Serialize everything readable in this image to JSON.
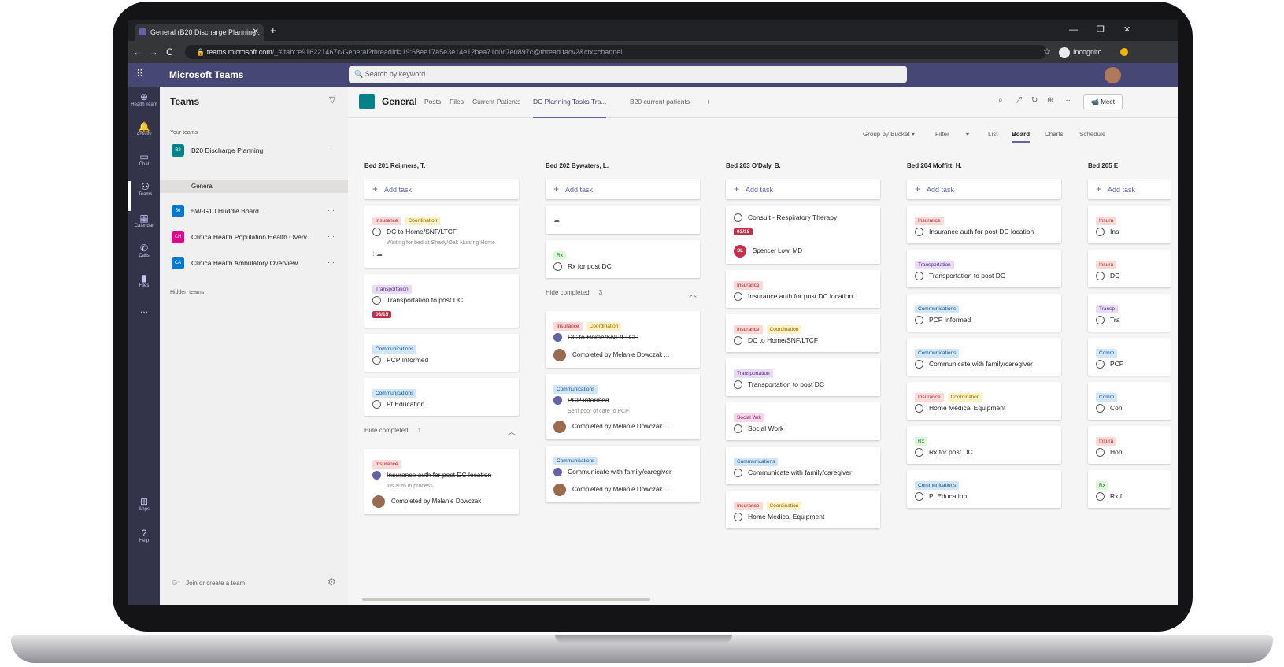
{
  "browser": {
    "tab_title": "General (B20 Discharge Planning...",
    "tab_close": "✕",
    "new_tab": "+",
    "window_controls": [
      "—",
      "❐",
      "✕"
    ],
    "nav": [
      "←",
      "→",
      "C"
    ],
    "url_host": "teams.microsoft.com",
    "url_path": "/_#/tab::e916221467c/General?threadId=19:68ee17a5e3e14e12bea71d0c7e0897c@thread.tacv2&ctx=channel",
    "incognito_label": "Incognito"
  },
  "teams": {
    "app_title": "Microsoft Teams",
    "search_placeholder": "Search by keyword",
    "rail": [
      "Health Team",
      "Activity",
      "Chat",
      "Teams",
      "Calendar",
      "Calls",
      "Files",
      "...",
      "Apps",
      "Help"
    ],
    "panel_title": "Teams",
    "your_teams_label": "Your teams",
    "teams_list": [
      {
        "logo": "B2",
        "name": "B20 Discharge Planning",
        "color": "#038387"
      },
      {
        "logo": "56",
        "name": "5W-G10 Huddle Board",
        "color": "#0078d4"
      },
      {
        "logo": "CH",
        "name": "Clinica Health Population Health Overv...",
        "color": "#e3008c"
      },
      {
        "logo": "CA",
        "name": "Clinica Health Ambulatory Overview",
        "color": "#0078d4"
      }
    ],
    "channel": "General",
    "hidden_teams_label": "Hidden teams",
    "join_label": "Join or create a team"
  },
  "channel_header": {
    "name": "General",
    "tabs": [
      "Posts",
      "Files",
      "Current Patients",
      "DC Planning Tasks Tra...",
      "B20 current patients",
      "+"
    ],
    "meet_label": "Meet"
  },
  "board_bar": {
    "group_by": "Group by Bucket ▾",
    "filter": "Filter",
    "filter_caret": "▾",
    "views": [
      "List",
      "Board",
      "Charts",
      "Schedule"
    ]
  },
  "add_task_label": "Add task",
  "hide_completed_label": "Hide completed",
  "buckets": [
    {
      "title": "Bed 201 Reijmers, T.",
      "cards": [
        {
          "labels": [
            [
              "Insurance",
              "red"
            ],
            [
              "Coordination",
              "yellow"
            ]
          ],
          "task": "DC to Home/SNF/LTCF",
          "note": "Waiting for bed at Shady/Oak Nursing Home",
          "meta": "⁝  ☁"
        },
        {
          "labels": [
            [
              "Transportation",
              "purple"
            ]
          ],
          "task": "Transportation to post DC",
          "due": "03/15"
        },
        {
          "labels": [
            [
              "Communications",
              "blue"
            ]
          ],
          "task": "PCP Informed"
        },
        {
          "labels": [
            [
              "Communications",
              "blue"
            ]
          ],
          "task": "Pt Education"
        }
      ],
      "hide_count": "1",
      "done": [
        {
          "labels": [
            [
              "Insurance",
              "red"
            ]
          ],
          "task": "Insurance auth for post DC location",
          "note": "Ins auth in process",
          "by": "Completed by Melanie Dowczak"
        }
      ]
    },
    {
      "title": "Bed 202 Bywaters, L.",
      "cards": [
        {
          "labels": [],
          "task": "",
          "meta": "☁"
        },
        {
          "labels": [
            [
              "Rx",
              "green"
            ]
          ],
          "task": "Rx for post DC"
        }
      ],
      "hide_count": "3",
      "done": [
        {
          "labels": [
            [
              "Insurance",
              "red"
            ],
            [
              "Coordination",
              "yellow"
            ]
          ],
          "task": "DC to Home/SNF/LTCF",
          "by": "Completed by Melanie Dowczak ..."
        },
        {
          "labels": [
            [
              "Communications",
              "blue"
            ]
          ],
          "task": "PCP informed",
          "note": "Sent poor of care to PCP",
          "by": "Completed by Melanie Dowczak ..."
        },
        {
          "labels": [
            [
              "Communications",
              "blue"
            ]
          ],
          "task": "Communicate with family/caregiver",
          "by": "Completed by Melanie Dowczak ..."
        }
      ]
    },
    {
      "title": "Bed 203 O'Daly, B.",
      "cards": [
        {
          "labels": [],
          "task": "Consult - Respiratory Therapy",
          "due": "03/18",
          "person": "Spencer Low, MD",
          "initials": "SL"
        },
        {
          "labels": [
            [
              "Insurance",
              "red"
            ]
          ],
          "task": "Insurance auth for post DC location"
        },
        {
          "labels": [
            [
              "Insurance",
              "red"
            ],
            [
              "Coordination",
              "yellow"
            ]
          ],
          "task": "DC to Home/SNF/LTCF"
        },
        {
          "labels": [
            [
              "Transportation",
              "purple"
            ]
          ],
          "task": "Transportation to post DC"
        },
        {
          "labels": [
            [
              "Social Wrk",
              "pink"
            ]
          ],
          "task": "Social Work"
        },
        {
          "labels": [
            [
              "Communications",
              "blue"
            ]
          ],
          "task": "Communicate with family/caregiver"
        },
        {
          "labels": [
            [
              "Insurance",
              "red"
            ],
            [
              "Coordination",
              "yellow"
            ]
          ],
          "task": "Home Medical Equipment"
        }
      ]
    },
    {
      "title": "Bed 204 Moffitt, H.",
      "cards": [
        {
          "labels": [
            [
              "Insurance",
              "red"
            ]
          ],
          "task": "Insurance auth for post DC location"
        },
        {
          "labels": [
            [
              "Transportation",
              "purple"
            ]
          ],
          "task": "Transportation to post DC"
        },
        {
          "labels": [
            [
              "Communications",
              "blue"
            ]
          ],
          "task": "PCP Informed"
        },
        {
          "labels": [
            [
              "Communications",
              "blue"
            ]
          ],
          "task": "Communicate with family/caregiver"
        },
        {
          "labels": [
            [
              "Insurance",
              "red"
            ],
            [
              "Coordination",
              "yellow"
            ]
          ],
          "task": "Home Medical Equipment"
        },
        {
          "labels": [
            [
              "Rx",
              "green"
            ]
          ],
          "task": "Rx for post DC"
        },
        {
          "labels": [
            [
              "Communications",
              "blue"
            ]
          ],
          "task": "Pt Education"
        }
      ]
    },
    {
      "title": "Bed 205 E",
      "cards": [
        {
          "labels": [
            [
              "Insura",
              "red"
            ]
          ],
          "task": "Ins"
        },
        {
          "labels": [
            [
              "Insura",
              "red"
            ]
          ],
          "task": "DC"
        },
        {
          "labels": [
            [
              "Transp",
              "purple"
            ]
          ],
          "task": "Tra"
        },
        {
          "labels": [
            [
              "Comm",
              "blue"
            ]
          ],
          "task": "PCP"
        },
        {
          "labels": [
            [
              "Comm",
              "blue"
            ]
          ],
          "task": "Con"
        },
        {
          "labels": [
            [
              "Insura",
              "red"
            ]
          ],
          "task": "Hon"
        },
        {
          "labels": [
            [
              "Rx",
              "green"
            ]
          ],
          "task": "Rx f"
        }
      ]
    }
  ]
}
